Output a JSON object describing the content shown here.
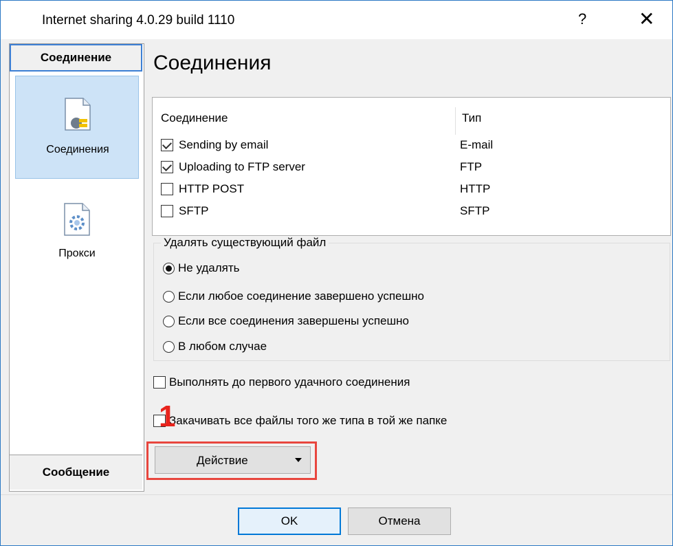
{
  "window": {
    "title": "Internet sharing 4.0.29 build 1110",
    "help_label": "?",
    "close_label": "✕"
  },
  "sidebar": {
    "header": "Соединение",
    "items": [
      {
        "label": "Соединения",
        "icon": "connection-document-icon",
        "selected": true
      },
      {
        "label": "Прокси",
        "icon": "gear-document-icon",
        "selected": false
      }
    ],
    "footer": "Сообщение"
  },
  "main": {
    "title": "Соединения",
    "list": {
      "columns": [
        "Соединение",
        "Тип"
      ],
      "rows": [
        {
          "name": "Sending by email",
          "type": "E-mail",
          "checked": true
        },
        {
          "name": "Uploading to FTP server",
          "type": "FTP",
          "checked": true
        },
        {
          "name": "HTTP POST",
          "type": "HTTP",
          "checked": false
        },
        {
          "name": "SFTP",
          "type": "SFTP",
          "checked": false
        }
      ]
    },
    "delete_group": {
      "label": "Удалять существующий файл",
      "options": [
        {
          "label": "Не удалять",
          "checked": true
        },
        {
          "label": "Если любое соединение завершено успешно",
          "checked": false
        },
        {
          "label": "Если все соединения завершены успешно",
          "checked": false
        },
        {
          "label": "В любом случае",
          "checked": false
        }
      ]
    },
    "option1": {
      "label": "Выполнять до первого удачного соединения",
      "checked": false
    },
    "option2": {
      "label": "Закачивать все файлы того же типа в той же папке",
      "checked": false
    },
    "marker": "1",
    "action_button": "Действие"
  },
  "footer": {
    "ok": "OK",
    "cancel": "Отмена"
  },
  "colors": {
    "accent": "#0078d7",
    "selection": "#cde3f7",
    "highlight": "#e8463e"
  }
}
